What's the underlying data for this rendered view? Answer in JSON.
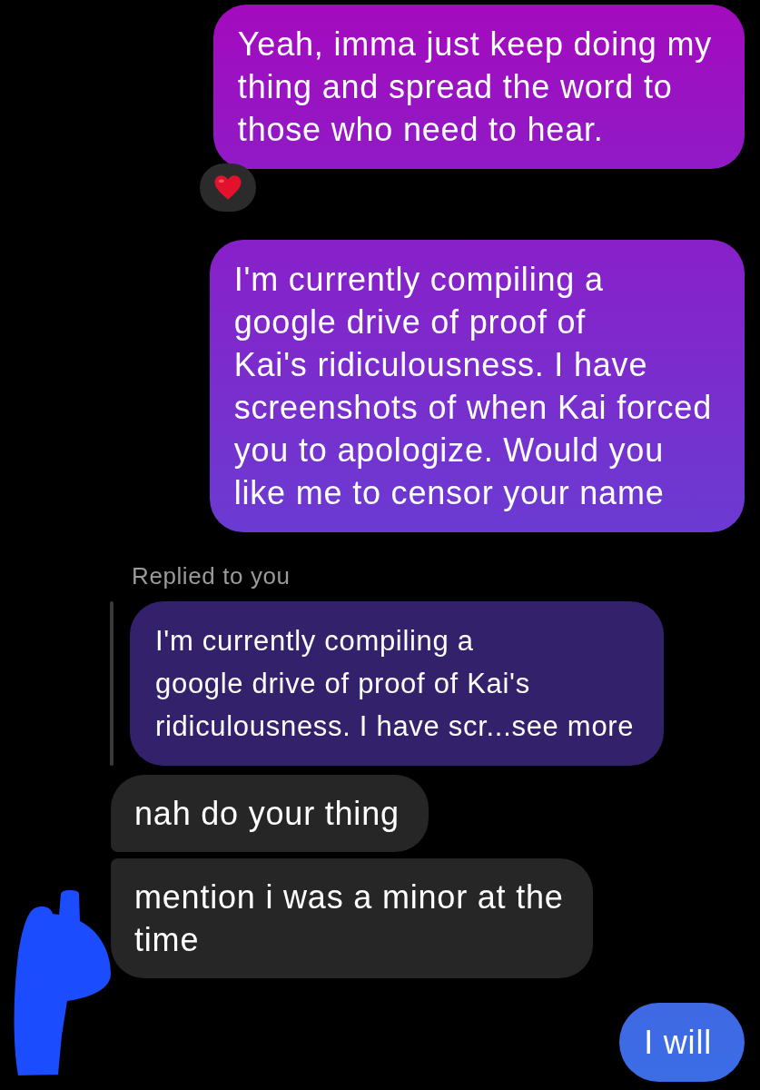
{
  "messages": [
    {
      "kind": "sent",
      "lines": [
        "Yeah, imma just keep doing my",
        "thing and spread the word to",
        "those who need to hear."
      ],
      "reacted": true
    },
    {
      "kind": "sent",
      "lines": [
        "I'm currently compiling a",
        "google drive of proof of",
        "Kai's ridiculousness. I have",
        "screenshots of when Kai forced",
        "you to apologize. Would you",
        "like me to censor your name"
      ],
      "reacted": false
    },
    {
      "kind": "reply",
      "label": "Replied to you",
      "quote_lines": [
        "I'm currently compiling a",
        "google drive of proof of Kai's",
        "ridiculousness. I have scr...see more"
      ]
    },
    {
      "kind": "received",
      "lines": [
        "nah do your thing"
      ],
      "reacted": false,
      "avatar": false
    },
    {
      "kind": "received",
      "lines": [
        "mention i was a minor at the",
        "time"
      ],
      "reacted": false,
      "avatar": true
    },
    {
      "kind": "sent",
      "lines": [
        "I will"
      ],
      "reacted": false
    }
  ]
}
